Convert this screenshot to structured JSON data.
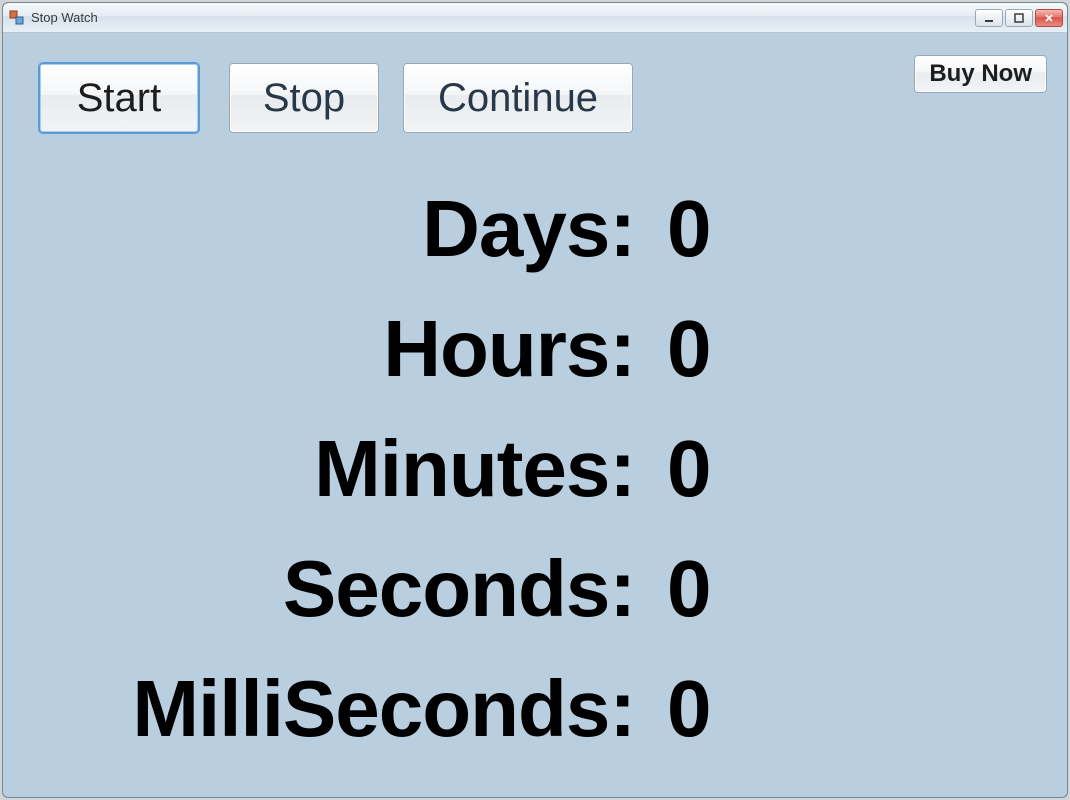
{
  "window": {
    "title": "Stop Watch"
  },
  "toolbar": {
    "start": "Start",
    "stop": "Stop",
    "continue": "Continue",
    "buy": "Buy Now"
  },
  "readout": {
    "days": {
      "label": "Days:",
      "value": "0"
    },
    "hours": {
      "label": "Hours:",
      "value": "0"
    },
    "minutes": {
      "label": "Minutes:",
      "value": "0"
    },
    "seconds": {
      "label": "Seconds:",
      "value": "0"
    },
    "milliseconds": {
      "label": "MilliSeconds:",
      "value": "0"
    }
  }
}
